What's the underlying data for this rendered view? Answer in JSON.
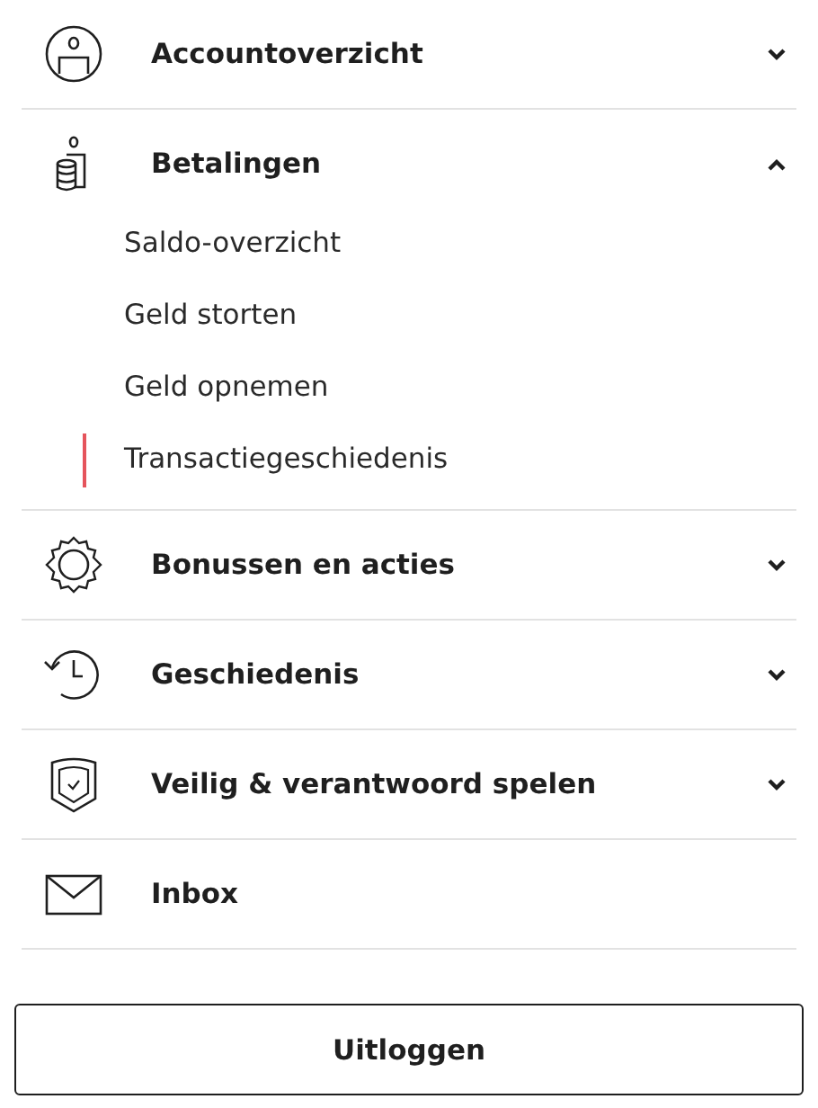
{
  "menu": [
    {
      "label": "Accountoverzicht",
      "kind": "group",
      "expanded": false
    },
    {
      "label": "Betalingen",
      "kind": "group",
      "expanded": true,
      "children": [
        {
          "label": "Saldo-overzicht",
          "selected": false
        },
        {
          "label": "Geld storten",
          "selected": false
        },
        {
          "label": "Geld opnemen",
          "selected": false
        },
        {
          "label": "Transactiegeschiedenis",
          "selected": true
        }
      ]
    },
    {
      "label": "Bonussen en acties",
      "kind": "group",
      "expanded": false
    },
    {
      "label": "Geschiedenis",
      "kind": "group",
      "expanded": false
    },
    {
      "label": "Veilig & verantwoord spelen",
      "kind": "group",
      "expanded": false
    },
    {
      "label": "Inbox",
      "kind": "link"
    }
  ],
  "logout_button": "Uitloggen"
}
